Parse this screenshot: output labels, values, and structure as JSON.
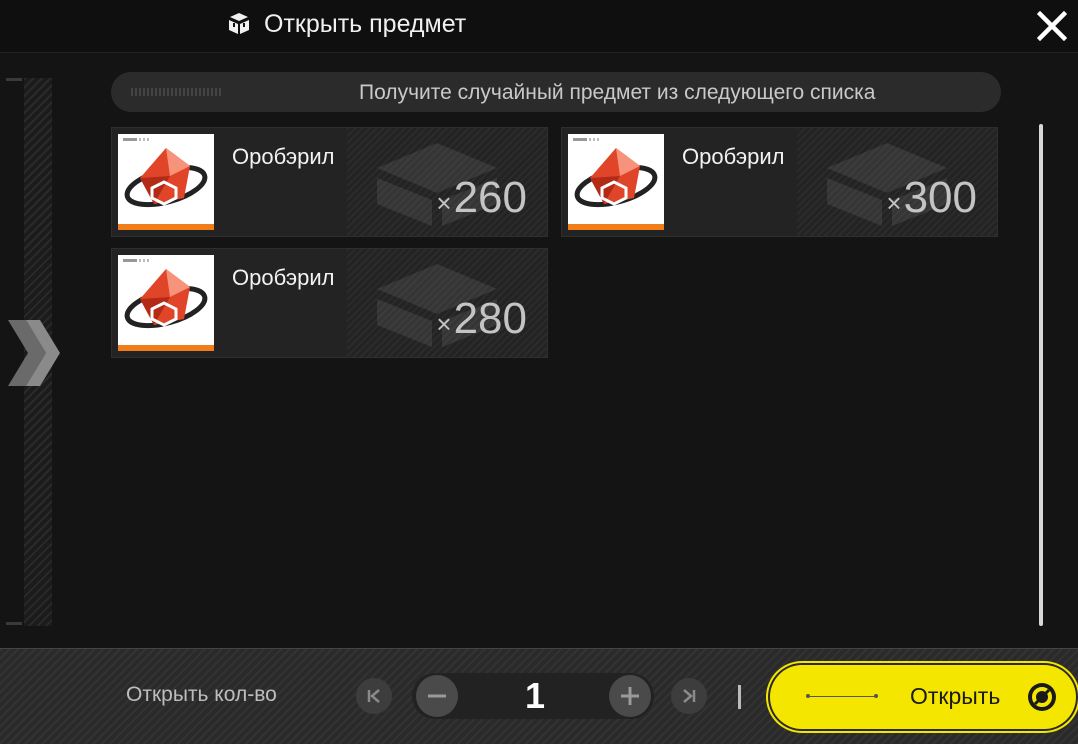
{
  "header": {
    "title": "Открыть предмет",
    "title_icon": "box-stack-icon",
    "close_icon": "close-icon"
  },
  "banner": {
    "text": "Получите случайный предмет из следующего списка"
  },
  "items": [
    {
      "name": "Оробэрил",
      "qty_prefix": "×",
      "qty": "260",
      "icon": "orberyl-crystal-icon"
    },
    {
      "name": "Оробэрил",
      "qty_prefix": "×",
      "qty": "300",
      "icon": "orberyl-crystal-icon"
    },
    {
      "name": "Оробэрил",
      "qty_prefix": "×",
      "qty": "280",
      "icon": "orberyl-crystal-icon"
    }
  ],
  "footer": {
    "qty_label": "Открыть кол-во",
    "quantity": "1",
    "min_icon": "skip-to-min-icon",
    "minus_icon": "minus-icon",
    "plus_icon": "plus-icon",
    "max_icon": "skip-to-max-icon",
    "open_label": "Открыть",
    "open_icon": "ring-icon"
  },
  "colors": {
    "accent": "#f5e600",
    "rarity_bar": "#f07c1a",
    "background": "#141414"
  }
}
